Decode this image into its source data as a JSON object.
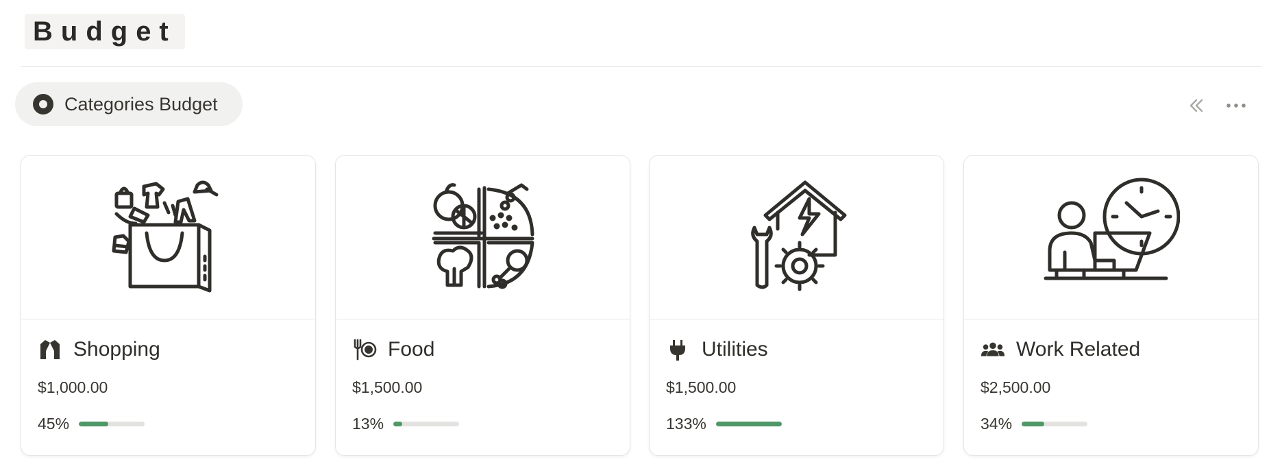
{
  "page": {
    "title": "Budget"
  },
  "view": {
    "label": "Categories Budget",
    "icon": "target-icon"
  },
  "toolbar": {
    "collapse_icon": "double-chevron-left-icon",
    "more_icon": "more-horizontal-icon"
  },
  "colors": {
    "progress_fill": "#4f9768",
    "progress_track": "#e3e2e0",
    "icon_stroke": "#2f2e2a"
  },
  "cards": [
    {
      "title": "Shopping",
      "icon": "jacket-icon",
      "cover_icon": "shopping-bag-illustration",
      "amount": "$1,000.00",
      "progress_label": "45%",
      "progress": 0.45
    },
    {
      "title": "Food",
      "icon": "utensils-plate-icon",
      "cover_icon": "food-groups-illustration",
      "amount": "$1,500.00",
      "progress_label": "13%",
      "progress": 0.13
    },
    {
      "title": "Utilities",
      "icon": "plug-icon",
      "cover_icon": "house-electricity-tools-illustration",
      "amount": "$1,500.00",
      "progress_label": "133%",
      "progress": 1.0
    },
    {
      "title": "Work Related",
      "icon": "people-group-icon",
      "cover_icon": "person-laptop-clock-illustration",
      "amount": "$2,500.00",
      "progress_label": "34%",
      "progress": 0.34
    }
  ]
}
